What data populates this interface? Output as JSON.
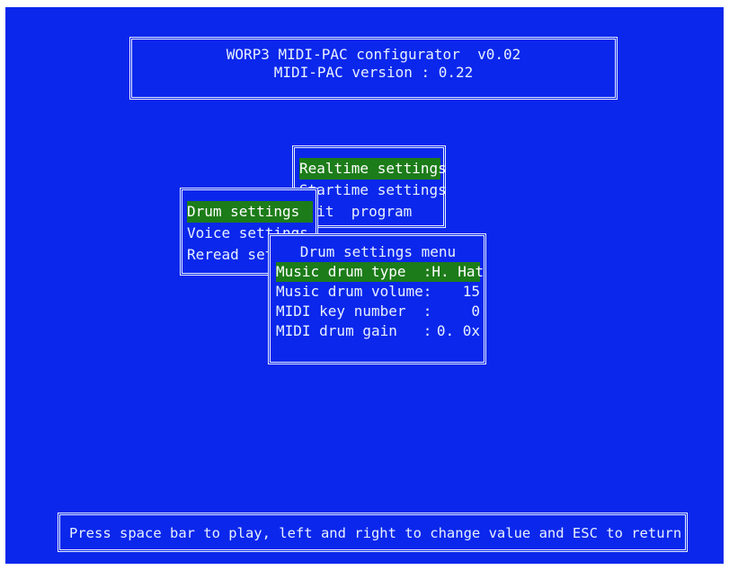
{
  "header": {
    "title": "WORP3 MIDI-PAC configurator  v0.02",
    "version": "MIDI-PAC version : 0.22"
  },
  "main_menu": {
    "items": [
      {
        "label": "Realtime settings",
        "selected": true
      },
      {
        "label": "Startime settings",
        "selected": false
      },
      {
        "label": "Exit  program",
        "selected": false
      }
    ]
  },
  "sub_menu": {
    "items": [
      {
        "label": "Drum settings",
        "selected": true
      },
      {
        "label": "Voice settings",
        "selected": false
      },
      {
        "label": "Reread settings",
        "selected": false
      }
    ]
  },
  "drum_menu": {
    "title": "Drum settings menu",
    "items": [
      {
        "label": "Music drum type  :",
        "value": "H. Hat",
        "selected": true
      },
      {
        "label": "Music drum volume:",
        "value": "15",
        "selected": false
      },
      {
        "label": "MIDI key number  :",
        "value": "0",
        "selected": false
      },
      {
        "label": "MIDI drum gain   :",
        "value": "0. 0x",
        "selected": false
      }
    ]
  },
  "status_bar": {
    "text": "Press space bar to play, left and right to change value and ESC to return"
  },
  "colors": {
    "background": "#0b27ec",
    "highlight": "#1c7c19",
    "text": "#e8f0ff"
  }
}
